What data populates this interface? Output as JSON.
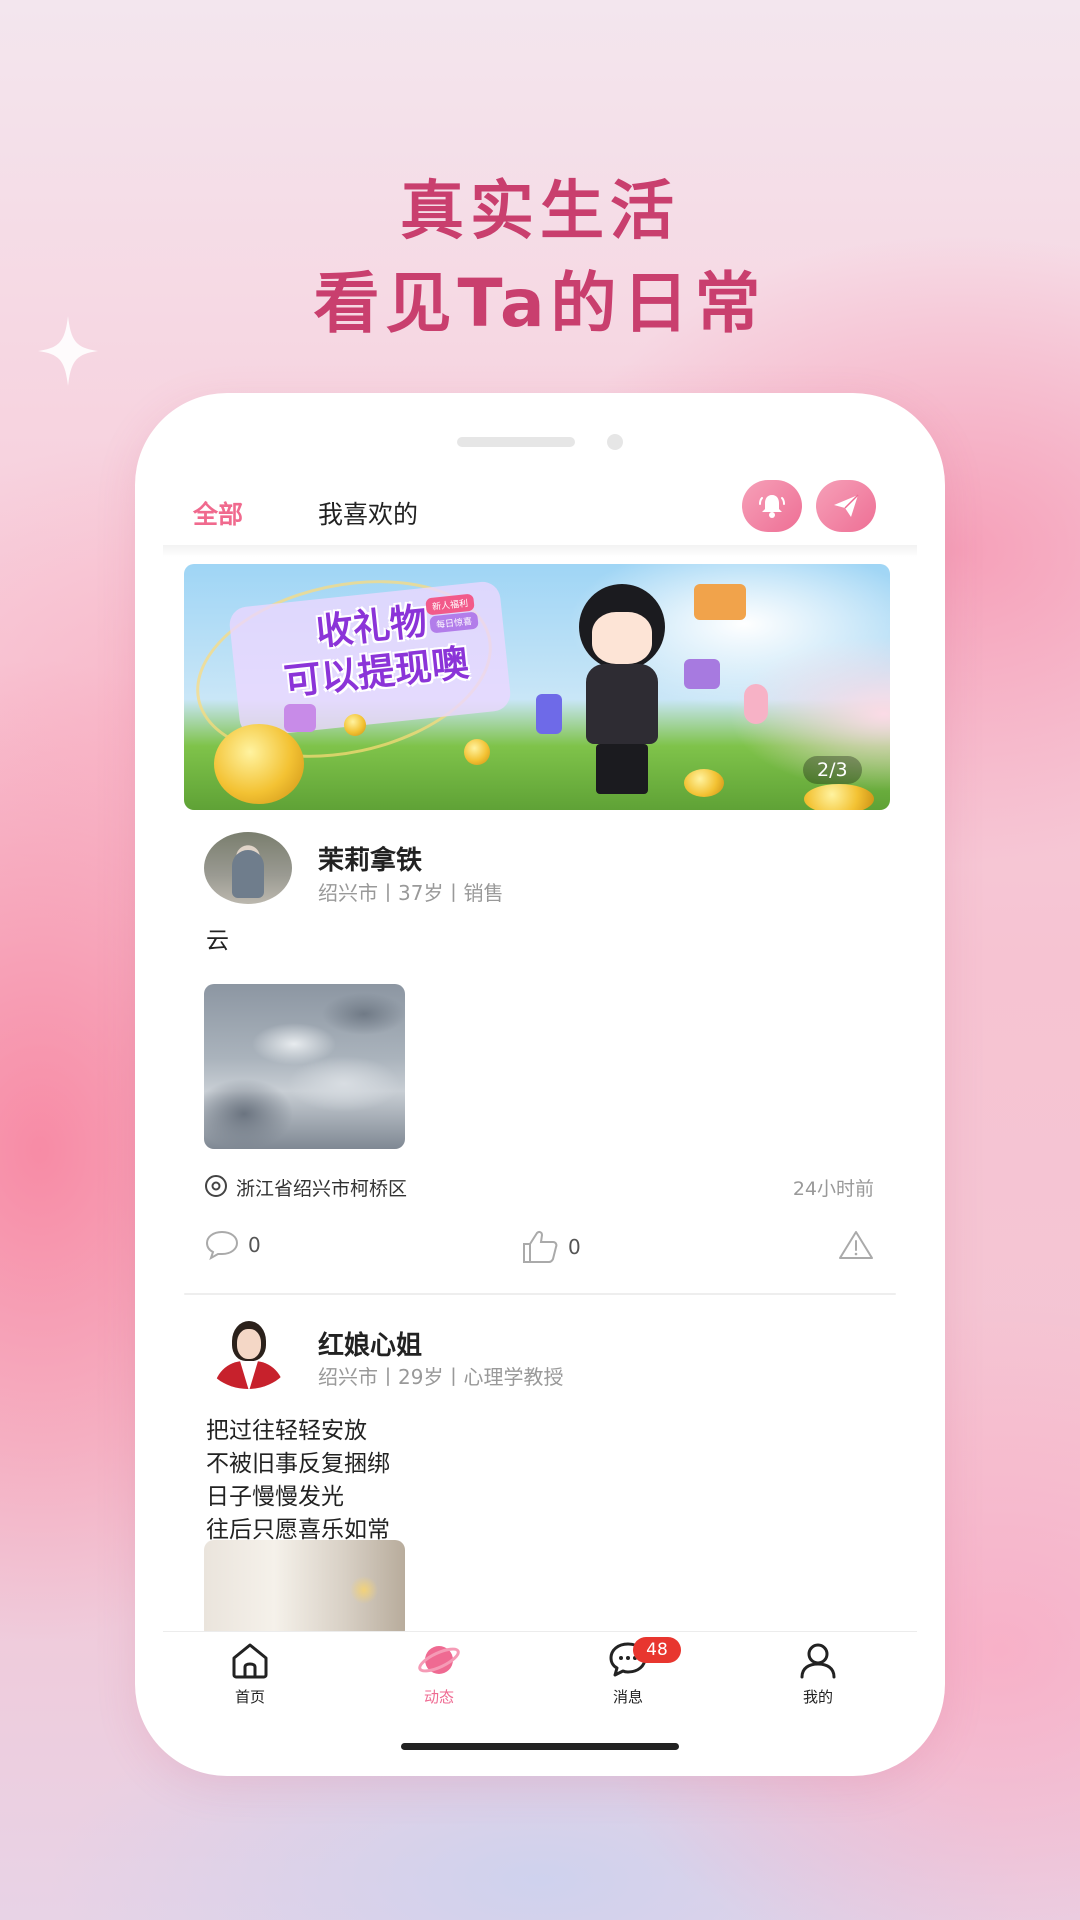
{
  "promo": {
    "headline_line1": "真实生活",
    "headline_line2": "看见Ta的日常"
  },
  "top_tabs": {
    "active": "全部",
    "other": "我喜欢的"
  },
  "top_icons": [
    "bell-icon",
    "send-icon"
  ],
  "banner": {
    "text_line1": "收礼物",
    "text_line2": "可以提现噢",
    "tag1": "新人福利",
    "tag2": "每日惊喜",
    "pager": "2/3"
  },
  "posts": [
    {
      "name": "茉莉拿铁",
      "meta": "绍兴市丨37岁丨销售",
      "content": [
        "云"
      ],
      "location": "浙江省绍兴市柯桥区",
      "time": "24小时前",
      "comments": "0",
      "likes": "0"
    },
    {
      "name": "红娘心姐",
      "meta": "绍兴市丨29岁丨心理学教授",
      "content": [
        "把过往轻轻安放",
        "不被旧事反复捆绑",
        "日子慢慢发光",
        "往后只愿喜乐如常"
      ]
    }
  ],
  "tabbar": {
    "items": [
      {
        "label": "首页",
        "icon": "home-icon"
      },
      {
        "label": "动态",
        "icon": "planet-icon"
      },
      {
        "label": "消息",
        "icon": "chat-icon"
      },
      {
        "label": "我的",
        "icon": "user-icon"
      }
    ],
    "active": "动态",
    "message_badge": "48"
  },
  "colors": {
    "accent": "#ef6a92",
    "headline": "#c93f6e",
    "badge": "#e8362f"
  }
}
